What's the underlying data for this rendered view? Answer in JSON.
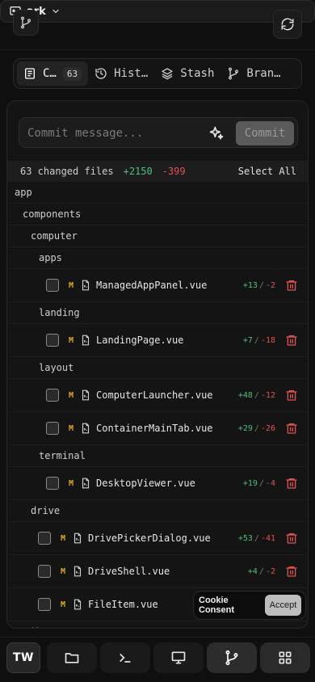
{
  "header": {
    "repo_name": "ark",
    "icons": {
      "branch": "git-branch-icon",
      "repo": "repo-icon",
      "chevron": "chevron-down-icon",
      "refresh": "refresh-icon"
    }
  },
  "tabs": [
    {
      "label": "C…",
      "count": "63",
      "icon": "commit-icon",
      "active": true
    },
    {
      "label": "Hist…",
      "icon": "history-icon"
    },
    {
      "label": "Stash",
      "icon": "layers-icon"
    },
    {
      "label": "Bran…",
      "icon": "git-branch-icon"
    }
  ],
  "commit": {
    "placeholder": "Commit message...",
    "button_label": "Commit"
  },
  "summary": {
    "files_label": "63 changed files",
    "additions": "+2150",
    "deletions": "-399",
    "select_all": "Select All"
  },
  "tree": {
    "app": "app",
    "components": "components",
    "computer": "computer",
    "apps": "apps",
    "landing": "landing",
    "layout": "layout",
    "terminal": "terminal",
    "drive": "drive",
    "files": [
      {
        "status": "M",
        "name": "ManagedAppPanel.vue",
        "add": "+13",
        "del": "-2"
      },
      {
        "status": "M",
        "name": "LandingPage.vue",
        "add": "+7",
        "del": "-18"
      },
      {
        "status": "M",
        "name": "ComputerLauncher.vue",
        "add": "+48",
        "del": "-12"
      },
      {
        "status": "M",
        "name": "ContainerMainTab.vue",
        "add": "+29",
        "del": "-26"
      },
      {
        "status": "M",
        "name": "DesktopViewer.vue",
        "add": "+19",
        "del": "-4"
      },
      {
        "status": "M",
        "name": "DrivePickerDialog.vue",
        "add": "+53",
        "del": "-41"
      },
      {
        "status": "M",
        "name": "DriveShell.vue",
        "add": "+4",
        "del": "-2"
      },
      {
        "status": "M",
        "name": "FileItem.vue",
        "add": "",
        "del": ""
      }
    ],
    "next_dir_partial": "edit"
  },
  "cookie": {
    "label": "Cookie Consent",
    "accept": "Accept"
  },
  "bottom_nav": {
    "logo": "TW",
    "items": [
      "folder-icon",
      "terminal-icon",
      "monitor-icon",
      "git-branch-icon",
      "grid-icon"
    ],
    "active": "git-branch-icon"
  },
  "colors": {
    "background": "#0f0f0f",
    "addition": "#4ec07a",
    "deletion": "#e05252",
    "modified": "#e0a62c",
    "trash": "#e05252"
  }
}
